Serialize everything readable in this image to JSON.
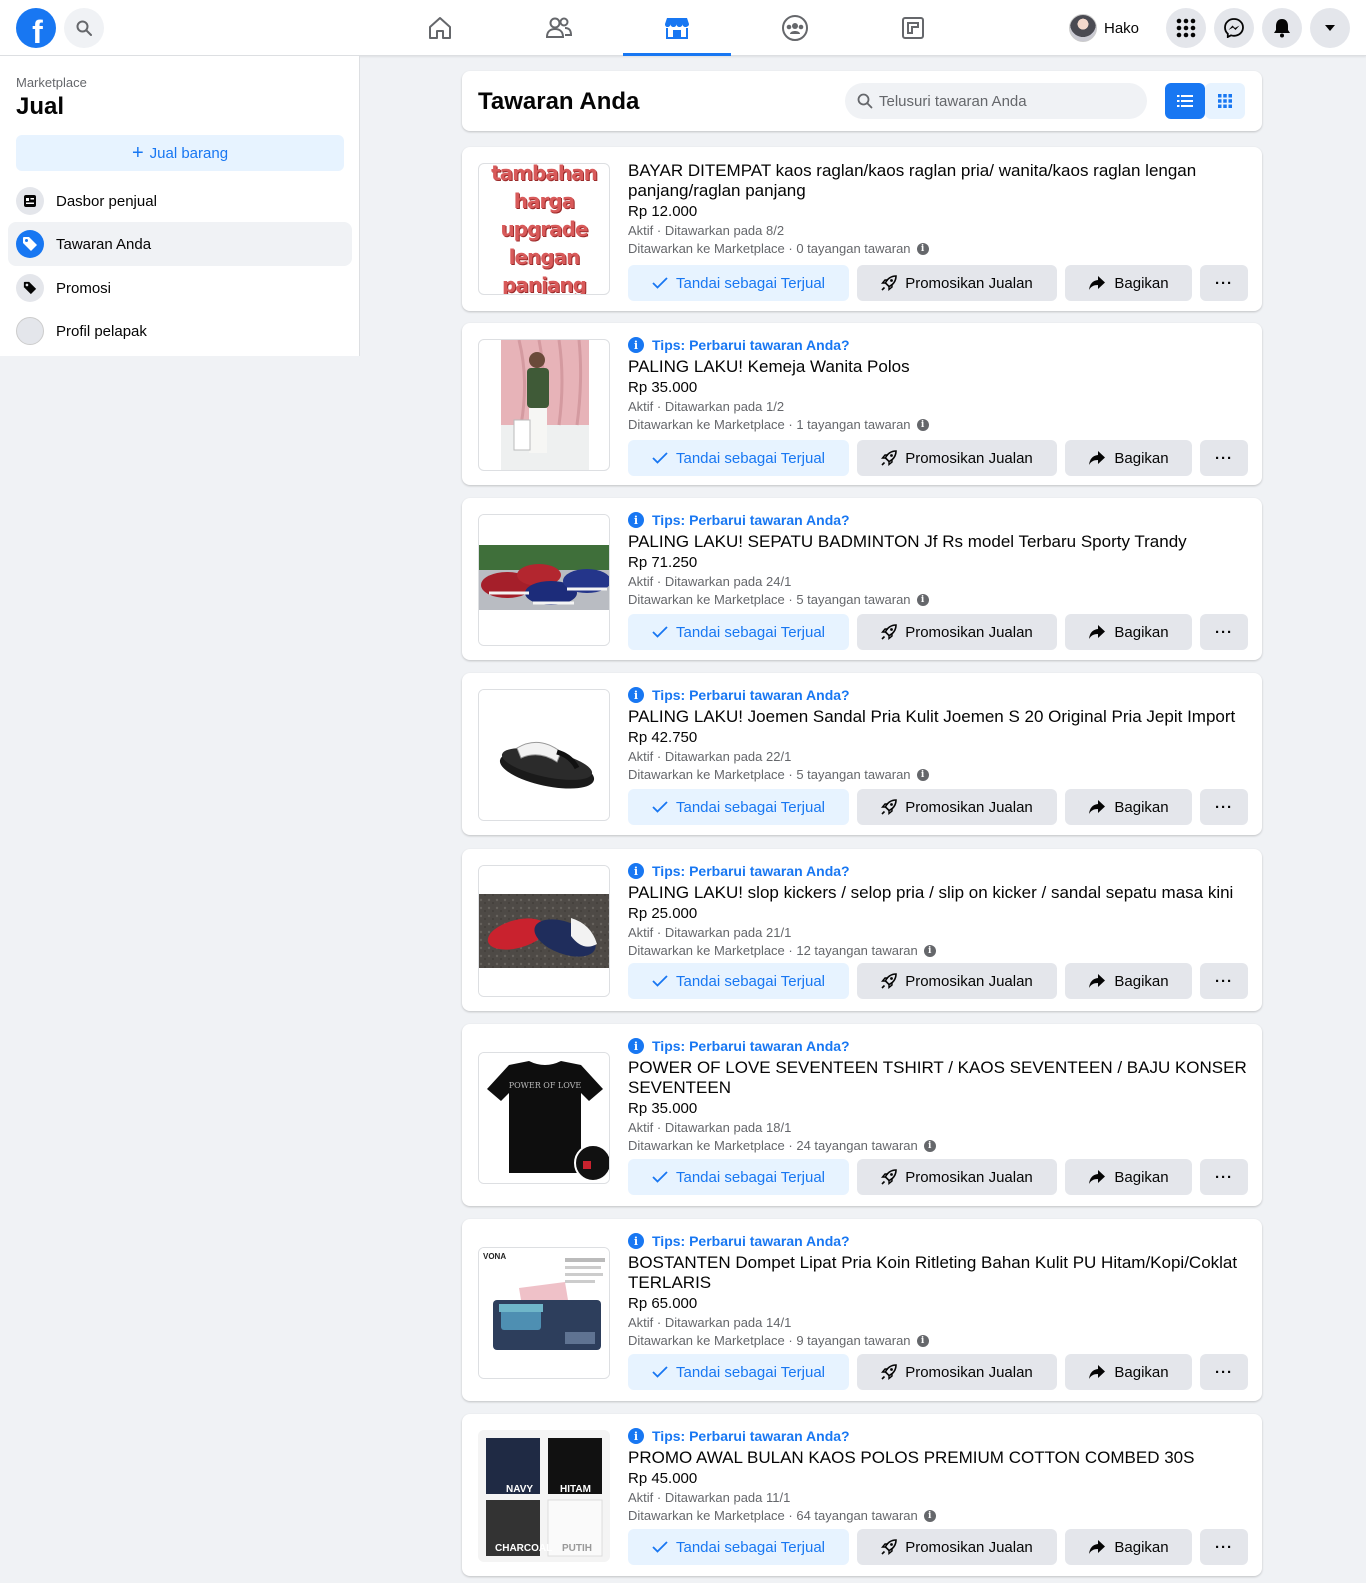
{
  "topbar": {
    "profile_name": "Hako"
  },
  "sidebar": {
    "subtitle": "Marketplace",
    "title": "Jual",
    "sell_button": "Jual barang",
    "items": [
      {
        "label": "Dasbor penjual"
      },
      {
        "label": "Tawaran Anda"
      },
      {
        "label": "Promosi"
      },
      {
        "label": "Profil pelapak"
      }
    ]
  },
  "header": {
    "title": "Tawaran Anda",
    "search_placeholder": "Telusuri tawaran Anda"
  },
  "actions": {
    "mark_sold": "Tandai sebagai Terjual",
    "promote": "Promosikan Jualan",
    "share": "Bagikan",
    "more": "···"
  },
  "tip_text": "Tips: Perbarui tawaran Anda?",
  "listings": [
    {
      "title": "BAYAR DITEMPAT kaos raglan/kaos raglan pria/ wanita/kaos raglan lengan panjang/raglan panjang",
      "price": "Rp 12.000",
      "status": "Aktif · Ditawarkan pada 8/2",
      "views": "Ditawarkan ke Marketplace · 0 tayangan tawaran",
      "thumb_text": "tambahan harga upgrade lengan panjang"
    },
    {
      "title": "PALING LAKU! Kemeja Wanita Polos",
      "price": "Rp 35.000",
      "status": "Aktif · Ditawarkan pada 1/2",
      "views": "Ditawarkan ke Marketplace · 1 tayangan tawaran"
    },
    {
      "title": "PALING LAKU! SEPATU BADMINTON Jf Rs model Terbaru Sporty Trandy",
      "price": "Rp 71.250",
      "status": "Aktif · Ditawarkan pada 24/1",
      "views": "Ditawarkan ke Marketplace · 5 tayangan tawaran"
    },
    {
      "title": "PALING LAKU! Joemen Sandal Pria Kulit Joemen S 20 Original Pria Jepit Import",
      "price": "Rp 42.750",
      "status": "Aktif · Ditawarkan pada 22/1",
      "views": "Ditawarkan ke Marketplace · 5 tayangan tawaran"
    },
    {
      "title": "PALING LAKU! slop kickers / selop pria / slip on kicker / sandal sepatu masa kini",
      "price": "Rp 25.000",
      "status": "Aktif · Ditawarkan pada 21/1",
      "views": "Ditawarkan ke Marketplace · 12 tayangan tawaran"
    },
    {
      "title": "POWER OF LOVE SEVENTEEN TSHIRT / KAOS SEVENTEEN / BAJU KONSER SEVENTEEN",
      "price": "Rp 35.000",
      "status": "Aktif · Ditawarkan pada 18/1",
      "views": "Ditawarkan ke Marketplace · 24 tayangan tawaran",
      "thumb_text": "POWER OF LOVE"
    },
    {
      "title": "BOSTANTEN Dompet Lipat Pria Koin Ritleting Bahan Kulit PU Hitam/Kopi/Coklat TERLARIS",
      "price": "Rp 65.000",
      "status": "Aktif · Ditawarkan pada 14/1",
      "views": "Ditawarkan ke Marketplace · 9 tayangan tawaran",
      "thumb_text": "VONA"
    },
    {
      "title": "PROMO AWAL BULAN KAOS POLOS PREMIUM COTTON COMBED 30S",
      "price": "Rp 45.000",
      "status": "Aktif · Ditawarkan pada 11/1",
      "views": "Ditawarkan ke Marketplace · 64 tayangan tawaran",
      "thumb_labels": [
        "NAVY",
        "HITAM",
        "CHARCOAL",
        "PUTIH"
      ]
    }
  ]
}
